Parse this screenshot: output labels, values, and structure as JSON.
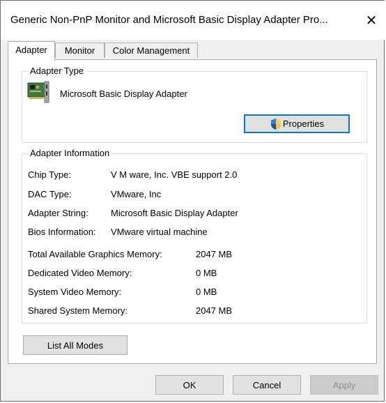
{
  "window": {
    "title": "Generic Non-PnP Monitor and Microsoft Basic Display Adapter Pro...",
    "close_glyph": "✕"
  },
  "tabs": [
    {
      "label": "Adapter",
      "active": true
    },
    {
      "label": "Monitor",
      "active": false
    },
    {
      "label": "Color Management",
      "active": false
    }
  ],
  "adapter_type": {
    "group_label": "Adapter Type",
    "icon": "display-adapter-card-icon",
    "name": "Microsoft Basic Display Adapter",
    "properties_label": "Properties",
    "properties_icon": "uac-shield-icon"
  },
  "adapter_info": {
    "group_label": "Adapter Information",
    "rows": [
      {
        "label": "Chip Type:",
        "value": "V M ware, Inc. VBE support 2.0"
      },
      {
        "label": "DAC Type:",
        "value": "VMware, Inc"
      },
      {
        "label": "Adapter String:",
        "value": "Microsoft Basic Display Adapter"
      },
      {
        "label": "Bios Information:",
        "value": "VMware virtual machine"
      }
    ],
    "memory": [
      {
        "label": "Total Available Graphics Memory:",
        "value": "2047 MB"
      },
      {
        "label": "Dedicated Video Memory:",
        "value": "0 MB"
      },
      {
        "label": "System Video Memory:",
        "value": "0 MB"
      },
      {
        "label": "Shared System Memory:",
        "value": "2047 MB"
      }
    ]
  },
  "list_all_modes_label": "List All Modes",
  "footer": {
    "ok": "OK",
    "cancel": "Cancel",
    "apply": "Apply"
  },
  "colors": {
    "accent": "#0078d7",
    "dialog_bg": "#f0f0f0",
    "button_bg": "#e1e1e1"
  }
}
